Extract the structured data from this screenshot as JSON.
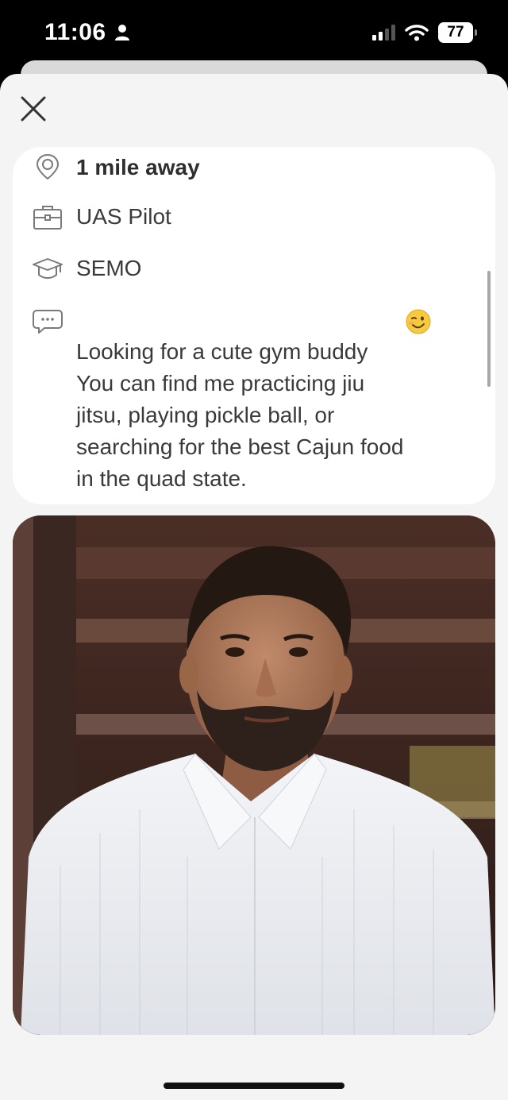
{
  "status_bar": {
    "time": "11:06",
    "battery": "77"
  },
  "profile": {
    "distance": "1 mile away",
    "job": "UAS Pilot",
    "school": "SEMO",
    "bio": "Looking for a cute gym buddy\nYou can find me practicing jiu\njitsu, playing pickle ball, or\nsearching for the best Cajun food\nin the quad state.",
    "bio_emoji": "winking-face-icon"
  },
  "icons": {
    "close": "close-icon",
    "location": "location-pin-icon",
    "job": "briefcase-icon",
    "school": "graduation-cap-icon",
    "bio": "speech-bubble-icon"
  },
  "colors": {
    "sheet_background": "#f4f4f4",
    "card_background": "#ffffff",
    "text": "#3a3a3a"
  }
}
